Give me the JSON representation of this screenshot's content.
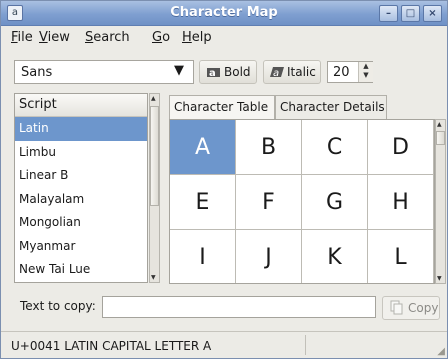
{
  "window": {
    "title": "Character Map",
    "app_icon": "a",
    "controls": {
      "minimize": "–",
      "maximize": "□",
      "close": "×"
    }
  },
  "menu": [
    {
      "label": "File",
      "mnemonic": "F"
    },
    {
      "label": "View",
      "mnemonic": "V"
    },
    {
      "label": "Search",
      "mnemonic": "S"
    },
    {
      "label": "Go",
      "mnemonic": "G"
    },
    {
      "label": "Help",
      "mnemonic": "H"
    }
  ],
  "toolbar": {
    "font_family": "Sans",
    "bold_label": "Bold",
    "italic_label": "Italic",
    "size": "20"
  },
  "script_panel": {
    "header": "Script",
    "items": [
      "Latin",
      "Limbu",
      "Linear B",
      "Malayalam",
      "Mongolian",
      "Myanmar",
      "New Tai Lue"
    ],
    "selected": "Latin"
  },
  "tabs": [
    {
      "label": "Character Table",
      "active": true
    },
    {
      "label": "Character Details",
      "active": false
    }
  ],
  "character_table": {
    "characters": [
      "A",
      "B",
      "C",
      "D",
      "E",
      "F",
      "G",
      "H",
      "I",
      "J",
      "K",
      "L"
    ],
    "selected": "A"
  },
  "copy_area": {
    "label": "Text to copy:",
    "value": "",
    "button_label": "Copy"
  },
  "status": {
    "text": "U+0041 LATIN CAPITAL LETTER A"
  },
  "colors": {
    "selection": "#6d96cc",
    "titlebar": "#7f9fd0"
  }
}
